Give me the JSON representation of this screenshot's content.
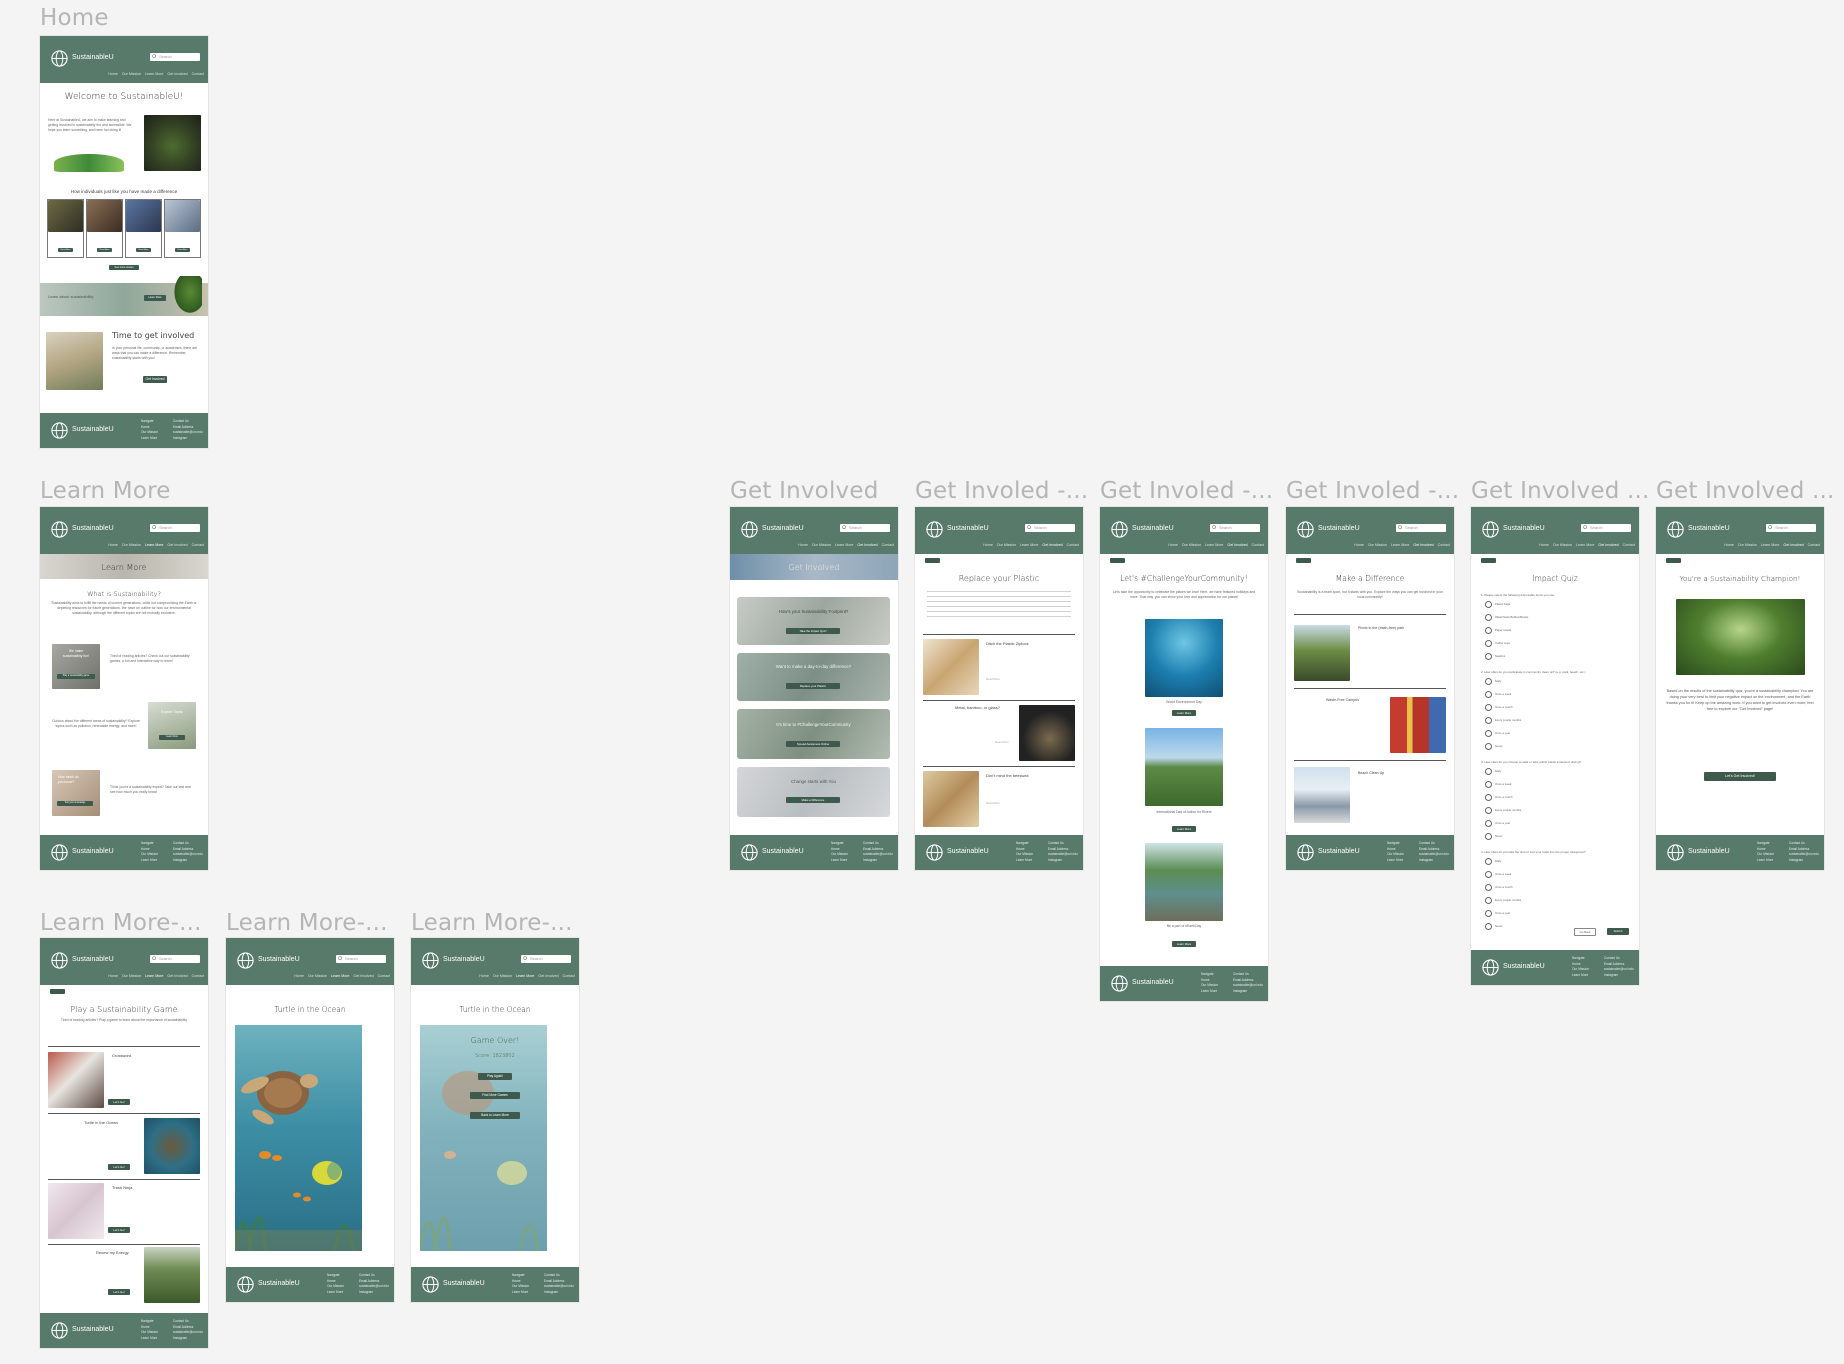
{
  "brand": "SustainableU",
  "search_placeholder": "Search",
  "nav": [
    "Home",
    "Our Mission",
    "Learn More",
    "Get Involved",
    "Contact"
  ],
  "footer": {
    "col1": [
      "Navigate",
      "Home",
      "Our Mission",
      "Learn More",
      "Get Involved"
    ],
    "col2": [
      "Contact Us",
      "Email Address",
      "sustainable@uni.edu",
      "(555) 555-5555",
      "Instagram"
    ]
  },
  "colors": {
    "primary": "#587a6b",
    "button": "#3d5a4c",
    "canvas": "#f4f4f4"
  },
  "labels": {
    "home": "Home",
    "learn": "Learn More",
    "lm_game": "Learn More-...",
    "lm_turtle": "Learn More-...",
    "lm_over": "Learn More-...",
    "gi": "Get Involved",
    "gi_plastic": "Get Involed -...",
    "gi_challenge": "Get Involed -...",
    "gi_diff": "Get Involed -...",
    "gi_quiz": "Get Involved ...",
    "gi_champ": "Get Involved ..."
  },
  "home": {
    "title": "Welcome to SustainableU!",
    "intro": "Here at SustainableU, we aim to make learning and getting involved in sustainability fun and accessible. We hope you learn something, and have fun doing it!",
    "difference": "How individuals just like you have made a difference",
    "banner": "Learn about sustainability",
    "banner_btn": "Learn More",
    "involved_title": "Time to get involved",
    "involved_text": "In your personal life, community, or academics, there are ways that you can make a difference. Remember, sustainability starts with you!",
    "involved_btn": "Get Involved",
    "stories_btn": "Read More",
    "see_more": "See more stories"
  },
  "learn": {
    "banner": "Learn More",
    "question": "What is Sustainability?",
    "text": "Sustainability aims to fulfill the needs of current generations, while not compromising the Earth or depleting resources for future generations. We have an outline for how our environmental sustainability, although the different topics are not mutually exclusive.",
    "row1_img": "We make sustainability fun!",
    "row1_text": "Tired of reading articles? Check out our sustainability games, a fun and interactive way to learn!",
    "row1_btn": "Play a sustainability game",
    "row2_img": "Explore Topics",
    "row2_text": "Curious about the different areas of sustainability? Explore topics such as pollution, renewable energy, and more!",
    "row2_btn": "Learn More",
    "row3_img": "How much do you know?",
    "row3_text": "Think you're a sustainability expert? Take our test and see how much you really know!",
    "row3_btn": "Test your knowledge"
  },
  "lm_game": {
    "title": "Play a Sustainability Game",
    "sub": "Tired of reading articles? Play a game to learn about the importance of sustainability",
    "games": [
      {
        "name": "Crossword",
        "btn": "Let's Go!"
      },
      {
        "name": "Turtle in the Ocean",
        "btn": "Let's Go!"
      },
      {
        "name": "Trash Ninja",
        "btn": "Let's Go!"
      },
      {
        "name": "Renew my Energy",
        "btn": "Let's Go!"
      }
    ]
  },
  "lm_turtle": {
    "title": "Turtle in the Ocean"
  },
  "lm_over": {
    "title": "Turtle in the Ocean",
    "over": "Game Over!",
    "score": "Score: 1823802",
    "b1": "Play Again!",
    "b2": "Find More Games",
    "b3": "Back to Learn More"
  },
  "gi": {
    "banner": "Get Involved",
    "cards": [
      {
        "t": "How's your Sustainability Footprint?",
        "b": "Take the Impact Quiz!"
      },
      {
        "t": "Want to make a day-to-day difference?",
        "b": "Replace your Plastic!"
      },
      {
        "t": "It's time to #ChallengeYourCommunity",
        "b": "Spread Awareness Online"
      },
      {
        "t": "Change starts with You",
        "b": "Make a Difference"
      }
    ]
  },
  "gi_plastic": {
    "title": "Replace your Plastic",
    "items": [
      {
        "t": "Ditch the Plastic Ziplocs"
      },
      {
        "t": "Metal, bamboo, or glass?"
      },
      {
        "t": "Don't mind the beeswax"
      }
    ],
    "more": "Read More"
  },
  "gi_challenge": {
    "title": "Let's #ChallengeYourCommunity!",
    "sub": "Let's take the opportunity to celebrate the places we love! Here, we have featured holidays and more. That way, you can show your love and appreciation for our planet!",
    "caps": [
      "World Environment Day",
      "International Day of Action for Rivers",
      "Be a part of #EarthDay"
    ],
    "btn": "Learn More"
  },
  "gi_diff": {
    "title": "Make a Difference",
    "sub": "Sustainability is a team sport, but it starts with you. Explore the ways you can get involved in your local community!",
    "items": [
      "Picnic in the (trash-free) park",
      "Waste-Free Campus",
      "Beach Clean Up"
    ]
  },
  "gi_quiz": {
    "title": "Impact Quiz",
    "q1": "1. Please select the following disposable items you use:",
    "q1o": [
      "Plastic bags",
      "Water/Soda Bottles/Straws",
      "Paper towels",
      "Coffee cups",
      "Napkins"
    ],
    "q2": "2. How often do you participate in community clean up? (e.g. park, beach, etc.)",
    "q2o": [
      "Daily",
      "Once a week",
      "Once a month",
      "Every couple months",
      "Once a year",
      "Never"
    ],
    "q3": "3. How often do you choose to walk or take public transit instead of driving?",
    "q3o": [
      "Daily",
      "Once a week",
      "Once a month",
      "Every couple months",
      "Once a year",
      "Never"
    ],
    "q4": "4. How often do you take the time to sort your trash into the proper categories?",
    "q4o": [
      "Daily",
      "Once a week",
      "Once a month",
      "Every couple months",
      "Once a year",
      "Never"
    ],
    "prev": "Go Back",
    "submit": "Submit"
  },
  "gi_champ": {
    "title": "You're a Sustainability Champion!",
    "text": "Based on the results of the sustainability quiz, you're a sustainability champion! You are doing your very best to limit your negative impact on the environment, and the Earth thanks you for it! Keep up the amazing work. If you want to get involved even more, feel free to explore our \"Get Involved\" page!",
    "btn": "Let's Get Involved!"
  }
}
